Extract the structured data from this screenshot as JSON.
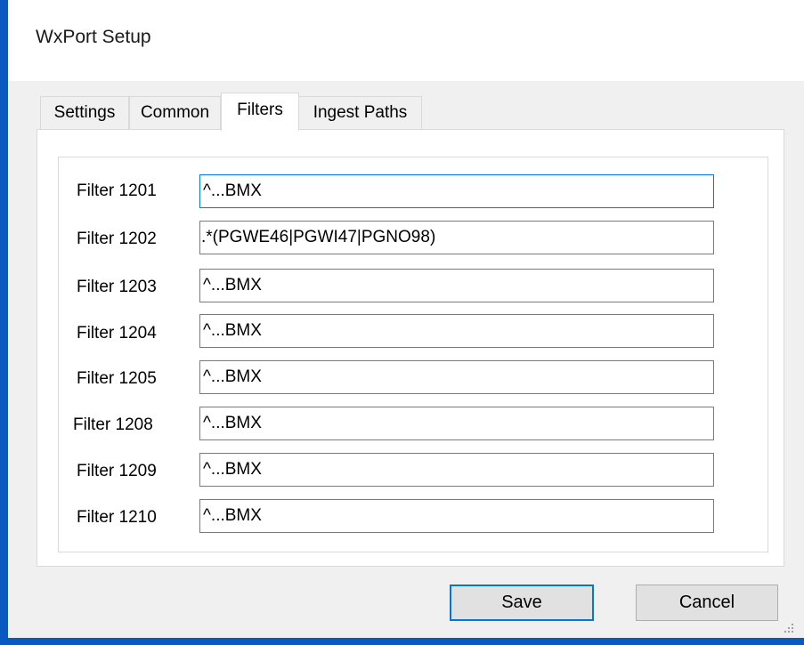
{
  "window": {
    "title": "WxPort Setup"
  },
  "tabs": [
    {
      "label": "Settings"
    },
    {
      "label": "Common"
    },
    {
      "label": "Filters"
    },
    {
      "label": "Ingest Paths"
    }
  ],
  "filters": [
    {
      "label": "Filter 1201",
      "value": "^...BMX"
    },
    {
      "label": "Filter 1202",
      "value": ".*(PGWE46|PGWI47|PGNO98)"
    },
    {
      "label": "Filter 1203",
      "value": "^...BMX"
    },
    {
      "label": "Filter 1204",
      "value": "^...BMX"
    },
    {
      "label": "Filter 1205",
      "value": "^...BMX"
    },
    {
      "label": "Filter 1208",
      "value": "^...BMX"
    },
    {
      "label": "Filter 1209",
      "value": "^...BMX"
    },
    {
      "label": "Filter 1210",
      "value": "^...BMX"
    }
  ],
  "buttons": {
    "save": "Save",
    "cancel": "Cancel"
  },
  "colors": {
    "accent": "#0078d7",
    "window_border": "#0a59c1"
  },
  "icons": {
    "grip": "size-grip-icon"
  }
}
